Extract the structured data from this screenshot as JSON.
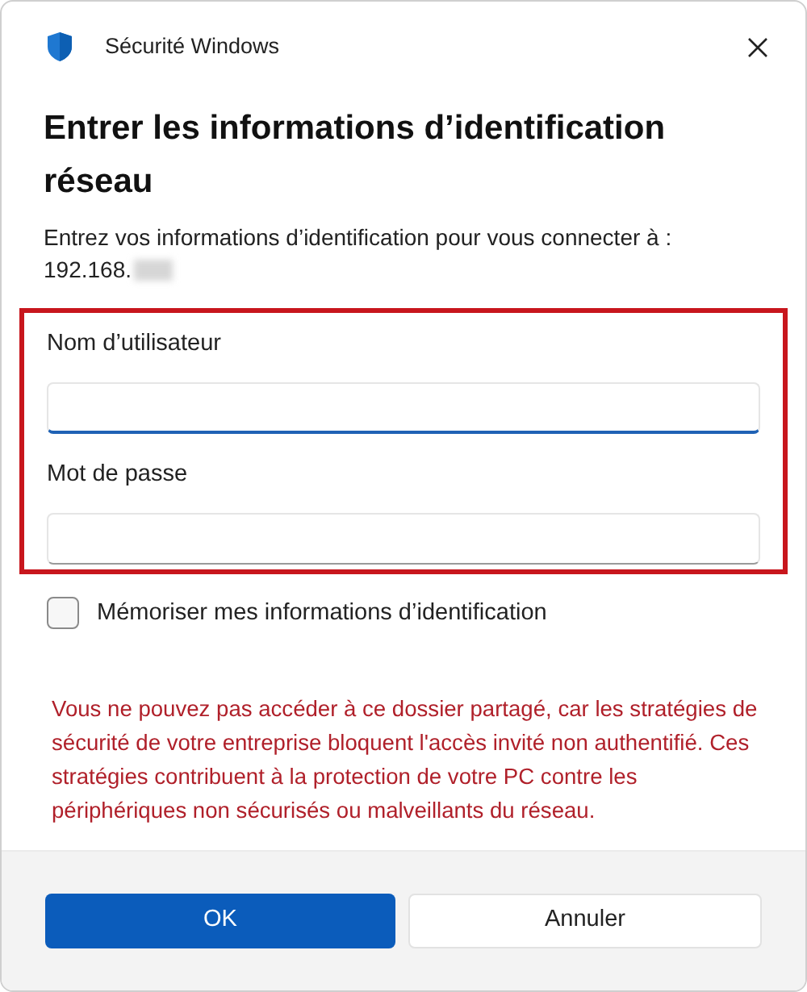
{
  "window": {
    "title": "Sécurité Windows"
  },
  "heading": "Entrer les informations d’identification réseau",
  "description": "Entrez vos informations d’identification pour vous connecter à :",
  "address": "192.168.",
  "fields": [
    {
      "label": "Nom d’utilisateur",
      "focused": true
    },
    {
      "label": "Mot de passe",
      "focused": false
    }
  ],
  "remember": {
    "label": "Mémoriser mes informations d’identification",
    "checked": false
  },
  "error": "Vous ne pouvez pas accéder à ce dossier partagé, car les stratégies de sécurité de votre entreprise bloquent l'accès invité non authentifié. Ces stratégies contribuent à la protection de votre PC contre les périphériques non sécurisés ou malveillants du réseau.",
  "buttons": [
    {
      "label": "OK",
      "kind": "primary"
    },
    {
      "label": "Annuler",
      "kind": "secondary"
    }
  ]
}
